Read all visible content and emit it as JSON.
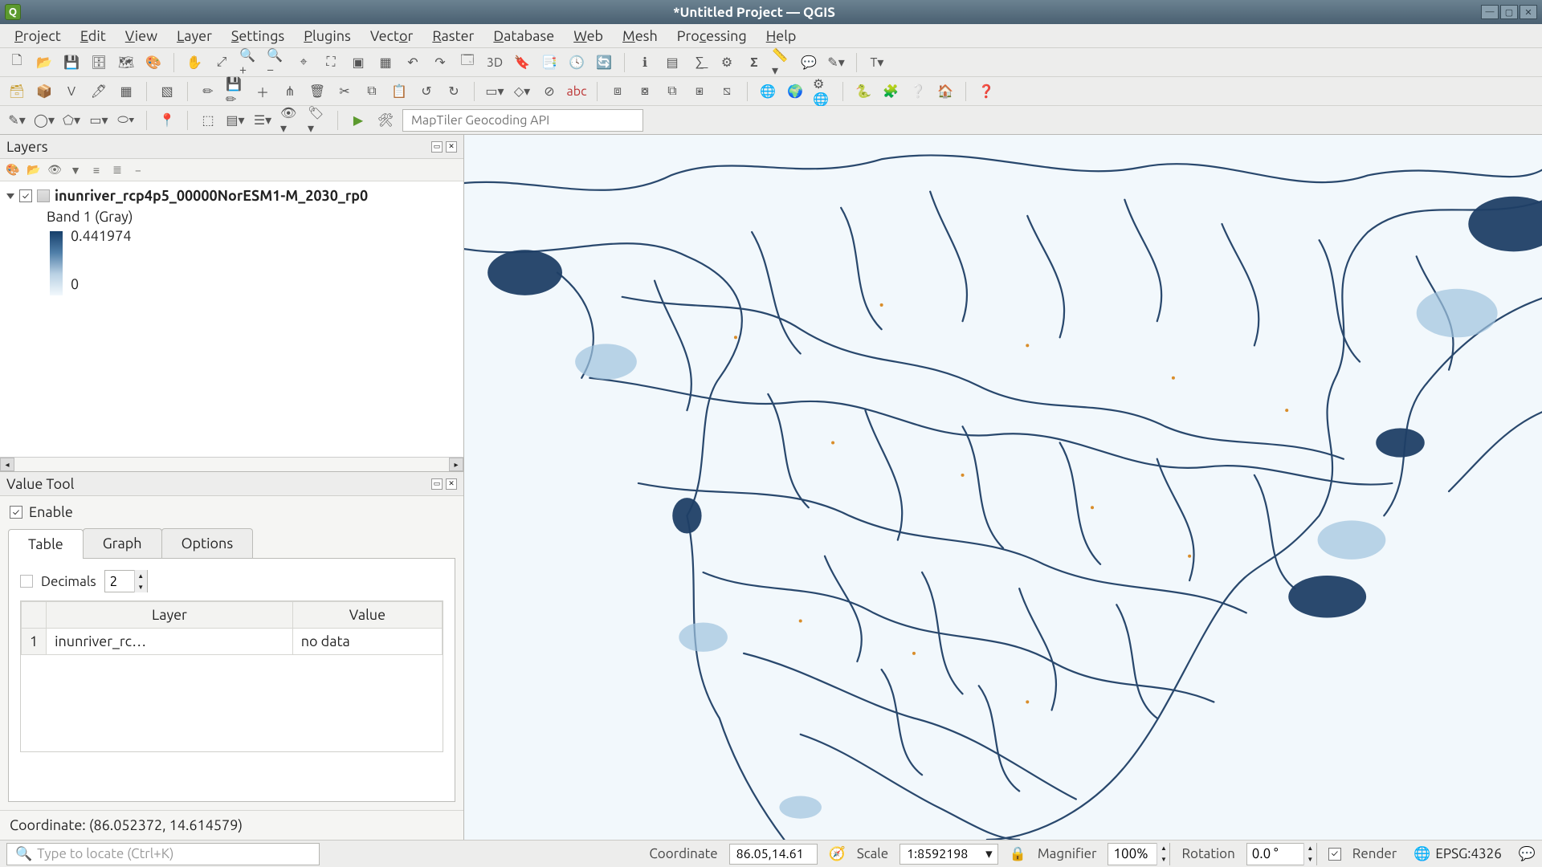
{
  "titlebar": {
    "title": "*Untitled Project — QGIS"
  },
  "menu": [
    "Project",
    "Edit",
    "View",
    "Layer",
    "Settings",
    "Plugins",
    "Vector",
    "Raster",
    "Database",
    "Web",
    "Mesh",
    "Processing",
    "Help"
  ],
  "search": {
    "placeholder": "MapTiler Geocoding API"
  },
  "layers_panel": {
    "title": "Layers",
    "layer_name": "inunriver_rcp4p5_00000NorESM1-M_2030_rp0",
    "band_label": "Band 1 (Gray)",
    "legend_max": "0.441974",
    "legend_min": "0"
  },
  "value_tool": {
    "title": "Value Tool",
    "enable": "Enable",
    "tabs": [
      "Table",
      "Graph",
      "Options"
    ],
    "decimals_label": "Decimals",
    "decimals_value": "2",
    "col_layer": "Layer",
    "col_value": "Value",
    "row_num": "1",
    "row_layer": "inunriver_rc…",
    "row_value": "no data",
    "coord_line": "Coordinate: (86.052372, 14.614579)"
  },
  "statusbar": {
    "locator_placeholder": "Type to locate (Ctrl+K)",
    "coord_label": "Coordinate",
    "coord_value": "86.05,14.61",
    "scale_label": "Scale",
    "scale_value": "1:8592198",
    "magnifier_label": "Magnifier",
    "magnifier_value": "100%",
    "rotation_label": "Rotation",
    "rotation_value": "0.0 °",
    "render_label": "Render",
    "crs": "EPSG:4326"
  }
}
